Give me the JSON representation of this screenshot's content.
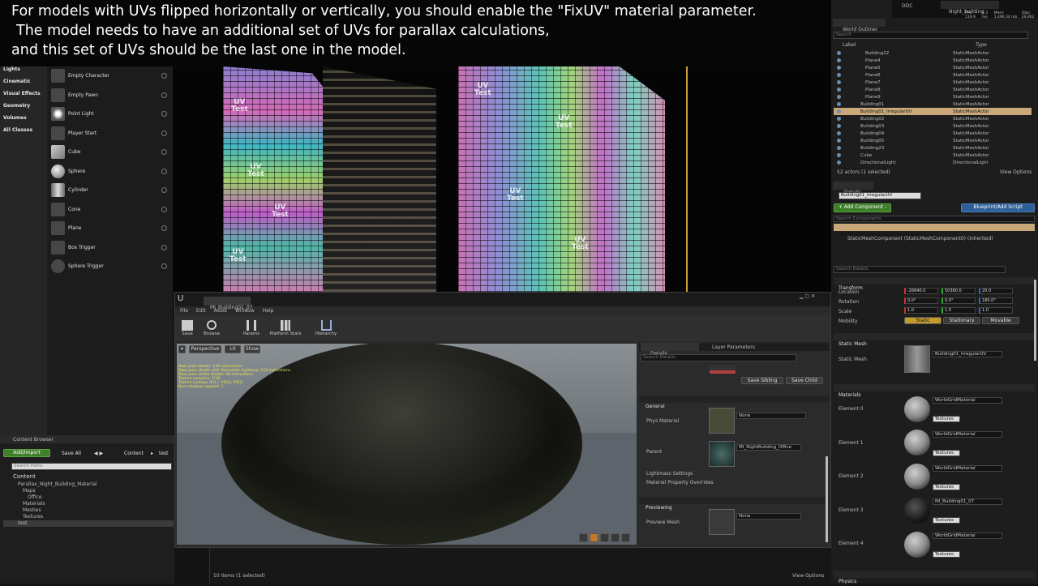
{
  "caption": {
    "lines": [
      "For models with UVs flipped horizontally or vertically, you should enable the \"FixUV\" material parameter.",
      "The model needs to have an additional set of UVs for parallax calculations,",
      "and this set of UVs should be the last one in the model."
    ]
  },
  "place": {
    "categories": [
      "Lights",
      "Cinematic",
      "Visual Effects",
      "Geometry",
      "Volumes",
      "All Classes"
    ],
    "items": [
      "Empty Character",
      "Empty Pawn",
      "Point Light",
      "Player Start",
      "Cube",
      "Sphere",
      "Cylinder",
      "Cone",
      "Plane",
      "Box Trigger",
      "Sphere Trigger"
    ]
  },
  "viewport": {
    "uv_label": "UV",
    "test_label": "Test"
  },
  "content_browser": {
    "tab": "Content Browser",
    "add_import": "Add/Import",
    "save_all": "Save All",
    "path": [
      "Content",
      "test"
    ],
    "search_placeholder": "Search Paths",
    "tree": [
      "Content",
      "Parallax_Night_Building_Material",
      "Maps",
      "Office",
      "Materials",
      "Meshes",
      "Textures",
      "test"
    ],
    "status": "10 items (1 selected)",
    "view_options": "View Options"
  },
  "material_editor": {
    "tab": "MI_Building01_07",
    "menu": [
      "File",
      "Edit",
      "Asset",
      "Window",
      "Help"
    ],
    "toolbar": [
      "Save",
      "Browse",
      "Params",
      "Platform Stats",
      "Hierarchy"
    ],
    "viewport_buttons": [
      "Perspective",
      "Lit",
      "Show"
    ],
    "stats": [
      "Base pass shader: 138 instructions",
      "Base pass shader with Volumetric Lightmap: 212 instructions",
      "Base pass vertex shader: 46 instructions",
      "Texture samplers: 5/16",
      "Texture Lookups (Est.): VS(0), PS(3)",
      "Num shadows applied: 1"
    ],
    "tabs": [
      "Details",
      "Layer Parameters"
    ],
    "search_placeholder": "Search Details",
    "save_sibling": "Save Sibling",
    "save_child": "Save Child",
    "general": "General",
    "phys_material": "Phys Material",
    "none": "None",
    "parent": "Parent",
    "parent_value": "MI_NightBuilding_Office",
    "lightmass": "Lightmass Settings",
    "override": "Material Property Overrides",
    "previewing": "Previewing",
    "preview_mesh": "Preview Mesh"
  },
  "top_right": {
    "ddc": "DDC",
    "level": "Night_building",
    "fps": "FPS: 119.9",
    "ms": "8.3 ms",
    "mem": "Mem: 1,496.34 mb",
    "objs": "Objs: 29,862"
  },
  "outliner": {
    "title": "World Outliner",
    "search_placeholder": "Search",
    "col_label": "Label",
    "col_type": "Type",
    "rows": [
      {
        "name": "Building22",
        "type": "StaticMeshActor"
      },
      {
        "name": "Plane4",
        "type": "StaticMeshActor"
      },
      {
        "name": "Plane5",
        "type": "StaticMeshActor"
      },
      {
        "name": "Plane6",
        "type": "StaticMeshActor"
      },
      {
        "name": "Plane7",
        "type": "StaticMeshActor"
      },
      {
        "name": "Plane8",
        "type": "StaticMeshActor"
      },
      {
        "name": "Plane9",
        "type": "StaticMeshActor"
      },
      {
        "name": "Building01",
        "type": "StaticMeshActor"
      },
      {
        "name": "Building01_IrregularUV",
        "type": "StaticMeshActor"
      },
      {
        "name": "Building02",
        "type": "StaticMeshActor"
      },
      {
        "name": "Building03",
        "type": "StaticMeshActor"
      },
      {
        "name": "Building04",
        "type": "StaticMeshActor"
      },
      {
        "name": "Building05",
        "type": "StaticMeshActor"
      },
      {
        "name": "Building23",
        "type": "StaticMeshActor"
      },
      {
        "name": "Cube",
        "type": "StaticMeshActor"
      },
      {
        "name": "DirectionalLight",
        "type": "DirectionalLight"
      }
    ],
    "status": "52 actors (1 selected)",
    "view_options": "View Options"
  },
  "details": {
    "tab": "Details",
    "object_name": "Building01_IrregularUV",
    "add_component": "+ Add Component -",
    "blueprint": "Blueprint/Add Script",
    "search_components": "Search Components",
    "instance": "Building01_IrregularUV(Instance)",
    "component": "StaticMeshComponent (StaticMeshComponent0) (Inherited)",
    "search_details": "Search Details",
    "transform": "Transform",
    "location": "Location",
    "rotation": "Rotation",
    "scale": "Scale",
    "mobility": "Mobility",
    "loc": [
      "-26840.0",
      "50380.0",
      "20.0"
    ],
    "rot": [
      "0.0°",
      "0.0°",
      "180.0°"
    ],
    "scl": [
      "1.0",
      "1.0",
      "1.0"
    ],
    "mob": [
      "Static",
      "Stationary",
      "Movable"
    ],
    "static_mesh_header": "Static Mesh",
    "static_mesh_label": "Static Mesh",
    "static_mesh_value": "Building01_IrregularUV",
    "materials": "Materials",
    "elements": [
      "Element 0",
      "Element 1",
      "Element 2",
      "Element 3",
      "Element 4"
    ],
    "element_values": [
      "WorldGridMaterial",
      "WorldGridMaterial",
      "WorldGridMaterial",
      "MI_Building01_07",
      "WorldGridMaterial"
    ],
    "textures": "Textures",
    "physics": "Physics"
  }
}
